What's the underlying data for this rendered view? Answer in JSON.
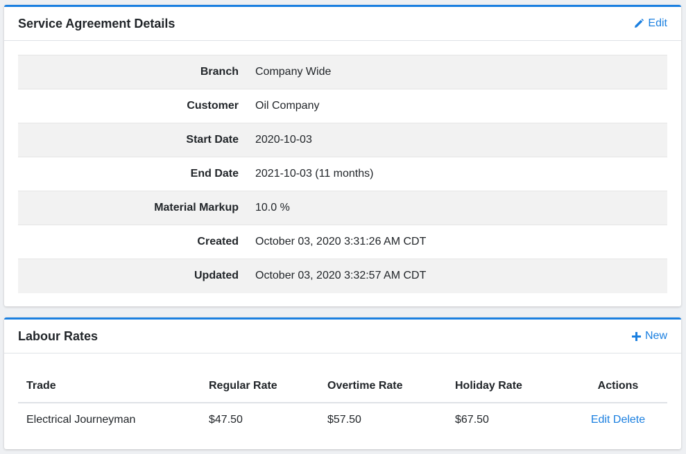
{
  "agreement": {
    "title": "Service Agreement Details",
    "edit_label": "Edit",
    "rows": [
      {
        "label": "Branch",
        "value": "Company Wide"
      },
      {
        "label": "Customer",
        "value": "Oil Company"
      },
      {
        "label": "Start Date",
        "value": "2020-10-03"
      },
      {
        "label": "End Date",
        "value": "2021-10-03 (11 months)"
      },
      {
        "label": "Material Markup",
        "value": "10.0 %"
      },
      {
        "label": "Created",
        "value": "October 03, 2020 3:31:26 AM CDT"
      },
      {
        "label": "Updated",
        "value": "October 03, 2020 3:32:57 AM CDT"
      }
    ]
  },
  "labour": {
    "title": "Labour Rates",
    "new_label": "New",
    "columns": [
      "Trade",
      "Regular Rate",
      "Overtime Rate",
      "Holiday Rate",
      "Actions"
    ],
    "rows": [
      {
        "trade": "Electrical Journeyman",
        "regular": "$47.50",
        "overtime": "$57.50",
        "holiday": "$67.50",
        "edit": "Edit",
        "delete": "Delete"
      }
    ]
  },
  "colors": {
    "accent": "#1a7fe0",
    "stripe": "#f2f2f2"
  },
  "icons": {
    "edit": "pencil-icon",
    "new": "plus-icon"
  }
}
